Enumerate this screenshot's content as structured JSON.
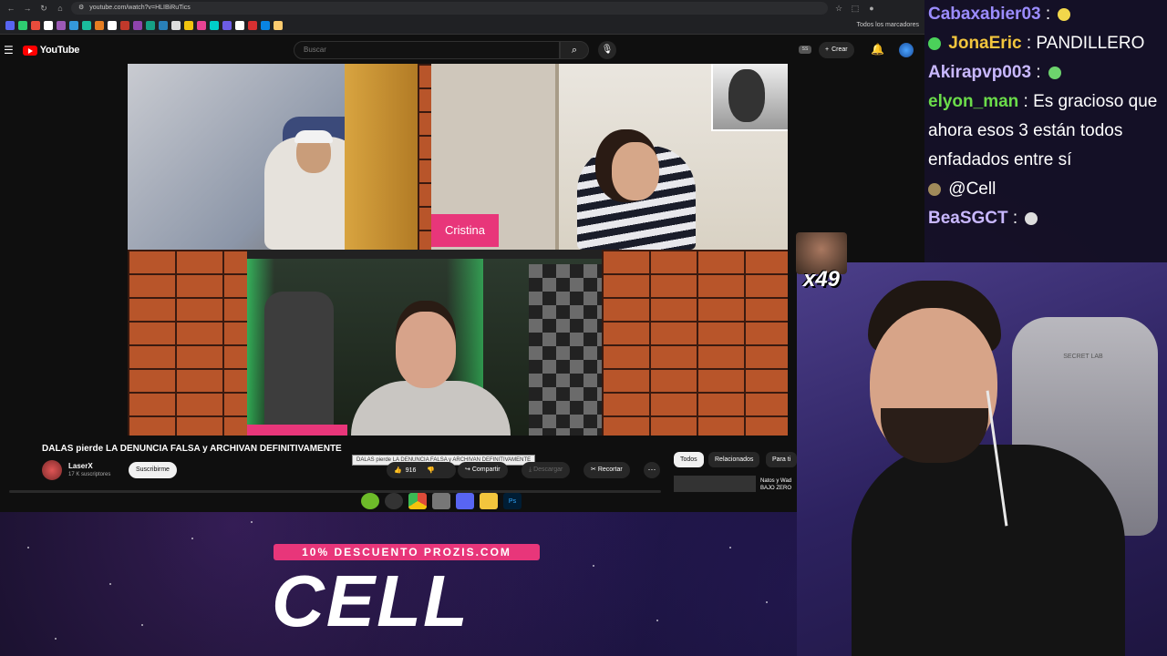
{
  "browser": {
    "url": "youtube.com/watch?v=HLIBiRuTics",
    "bookmarks_folder": "Todos los marcadores"
  },
  "youtube": {
    "logo": "YouTube",
    "search_placeholder": "Buscar",
    "ss_badge": "SS",
    "create_label": "Crear"
  },
  "video": {
    "name_tag": "Cristina",
    "title": "DALAS pierde LA DENUNCIA FALSA y ARCHIVAN DEFINITIVAMENTE",
    "tooltip": "DALAS pierde LA DENUNCIA FALSA y ARCHIVAN DEFINITIVAMENTE",
    "channel_name": "LaserX",
    "channel_subs": "17 K suscriptores",
    "subscribe_label": "Suscribirme",
    "like_count": "916",
    "share_label": "Compartir",
    "download_label": "Descargar",
    "clip_label": "Recortar"
  },
  "sidebar": {
    "chips": [
      "Todos",
      "Relacionados",
      "Para ti"
    ],
    "rec_title": "Natos y Wad BAJO ZERO"
  },
  "taskbar": {
    "apps": [
      {
        "icon": "xbox-icon",
        "color": "#6dbb29"
      },
      {
        "icon": "obs-icon",
        "color": "#333333"
      },
      {
        "icon": "chrome-icon",
        "color": "#dd4b39"
      },
      {
        "icon": "app-icon",
        "color": "#777777"
      },
      {
        "icon": "discord-icon",
        "color": "#5865f2"
      },
      {
        "icon": "folder-icon",
        "color": "#f2c53d"
      },
      {
        "icon": "photoshop-icon",
        "color": "#001d34"
      }
    ],
    "photoshop_label": "Ps"
  },
  "chat": {
    "messages": [
      {
        "user": "Cabaxabier03",
        "color": "#9b8cff",
        "text": "",
        "emote_color": "#f2d74b"
      },
      {
        "user": "JonaEric",
        "color": "#f2c53d",
        "text": "PANDILLERO",
        "emote_color": ""
      },
      {
        "user": "Akirapvp003",
        "color": "#c9b8ff",
        "text": "",
        "emote_color": "#6dd36d"
      },
      {
        "user": "elyon_man",
        "color": "#6bdc4a",
        "text": "Es gracioso que ahora esos 3 están todos enfadados entre sí",
        "emote_color": ""
      },
      {
        "user": "",
        "color": "#ffffff",
        "text": "@Cell",
        "emote_color": "#a08a5a"
      },
      {
        "user": "BeaSGCT",
        "color": "#c9b8ff",
        "text": "",
        "emote_color": "#dddddd"
      }
    ]
  },
  "webcam": {
    "chair_logo": "SECRET LAB"
  },
  "emote": {
    "count": "x49"
  },
  "promo": {
    "banner": "10% DESCUENTO PROZIS.COM",
    "name": "CELL"
  }
}
